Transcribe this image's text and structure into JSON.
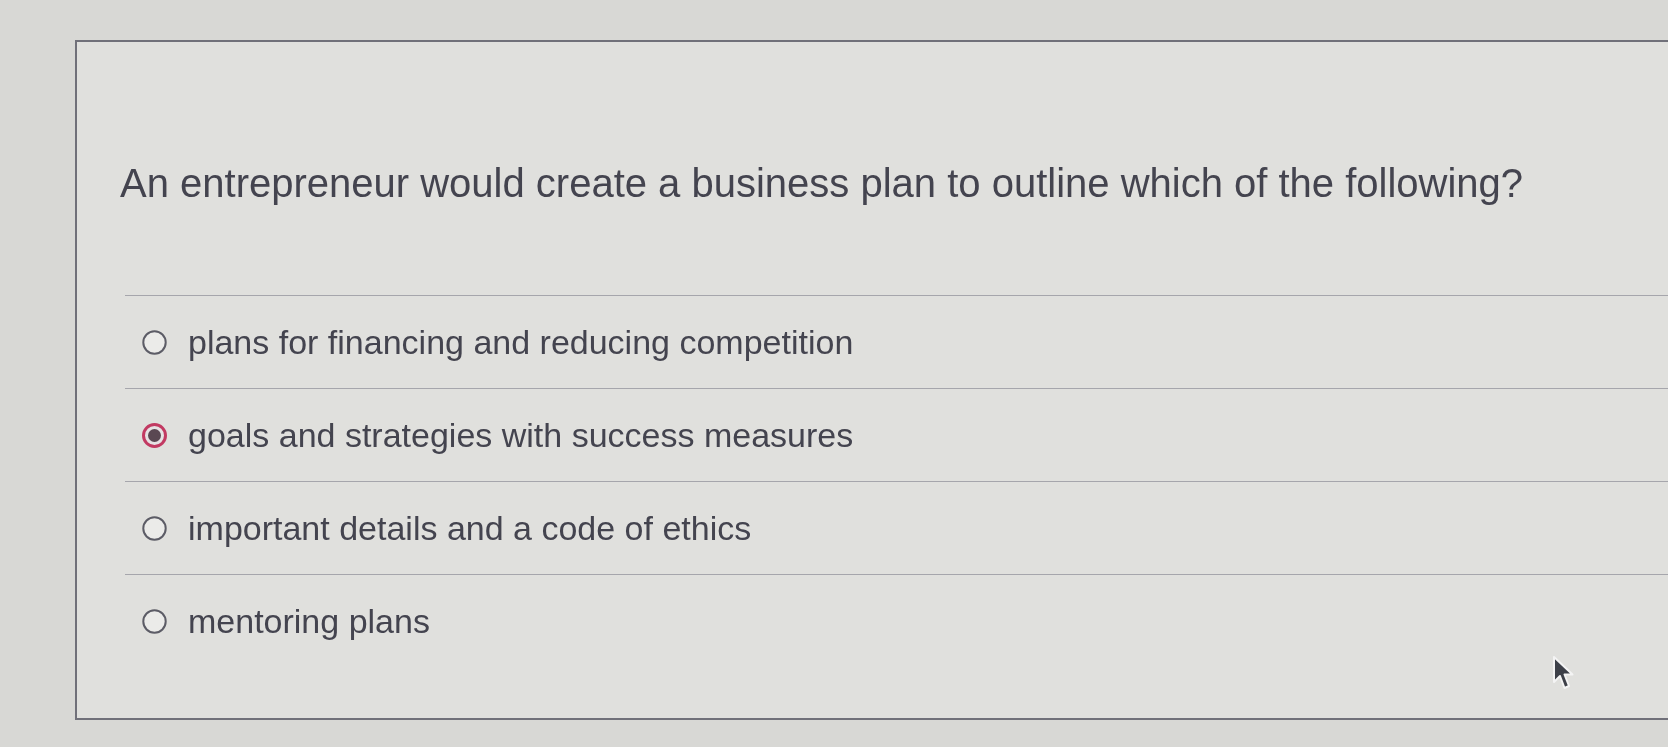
{
  "question": {
    "text": "An entrepreneur would create a business plan to outline which of the following?"
  },
  "options": [
    {
      "label": "plans for financing and reducing competition",
      "selected": false
    },
    {
      "label": "goals and strategies with success measures",
      "selected": true
    },
    {
      "label": "important details and a code of ethics",
      "selected": false
    },
    {
      "label": "mentoring plans",
      "selected": false
    }
  ]
}
